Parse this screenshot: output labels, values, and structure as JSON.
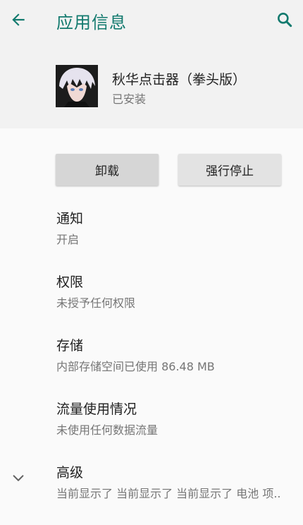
{
  "appbar": {
    "title": "应用信息",
    "back_icon": "arrow-left-icon",
    "search_icon": "search-icon",
    "accent_color": "#127a6e"
  },
  "app": {
    "name": "秋华点击器（拳头版）",
    "status": "已安装",
    "icon": "anime-avatar-icon"
  },
  "buttons": {
    "uninstall": "卸载",
    "force_stop": "强行停止"
  },
  "items": [
    {
      "title": "通知",
      "subtitle": "开启"
    },
    {
      "title": "权限",
      "subtitle": "未授予任何权限"
    },
    {
      "title": "存储",
      "subtitle": "内部存储空间已使用 86.48 MB"
    },
    {
      "title": "流量使用情况",
      "subtitle": "未使用任何数据流量"
    },
    {
      "title": "高级",
      "subtitle": "当前显示了 当前显示了 当前显示了 电池 项.."
    }
  ],
  "advanced_icon": "chevron-down-icon"
}
